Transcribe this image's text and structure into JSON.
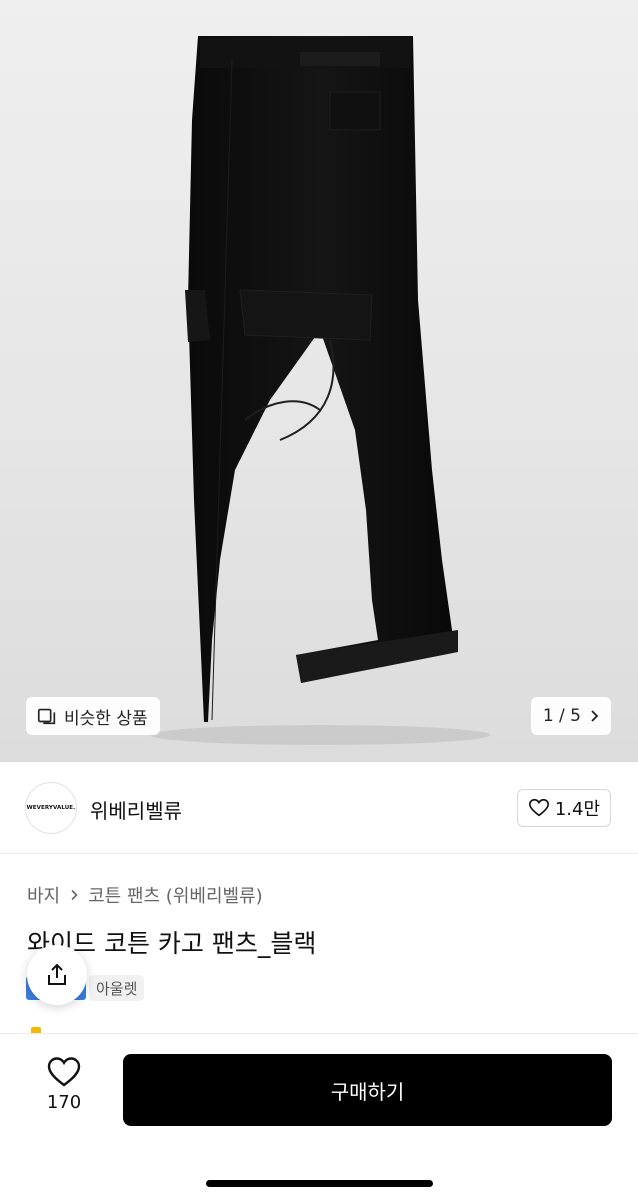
{
  "gallery": {
    "similar_label": "비슷한 상품",
    "page_indicator": "1 / 5"
  },
  "store": {
    "logo_text": "WEVERYVALUE.",
    "name": "위베리벨류",
    "likes": "1.4만"
  },
  "product": {
    "breadcrumb": [
      "바지",
      "코튼 팬츠 (위베리벨류)"
    ],
    "title": "와이드 코튼 카고 팬츠_블랙",
    "badge": "아울렛"
  },
  "bottom": {
    "like_count": "170",
    "buy_label": "구매하기"
  },
  "colors": {
    "accent": "#3b7de0",
    "buy_button": "#000000"
  },
  "icons": {
    "similar": "similar-products-icon",
    "next": "chevron-right-icon",
    "store_like": "heart-icon",
    "breadcrumb_sep": "chevron-right-icon",
    "share": "share-icon",
    "like": "heart-icon"
  }
}
